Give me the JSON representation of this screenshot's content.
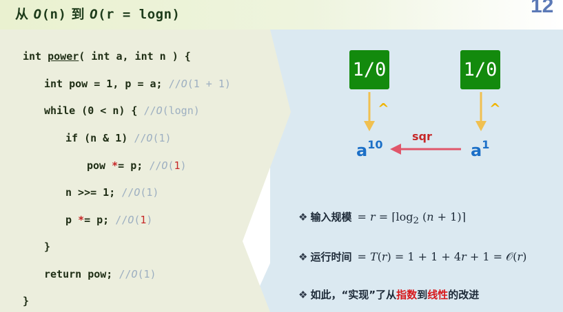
{
  "title": {
    "prefix": "从 ",
    "o1": "O",
    "part1": "(n)",
    "mid": " 到 ",
    "o2": "O",
    "part2": "(r = logn)"
  },
  "slide_number": "12",
  "code": {
    "lines": [
      {
        "kw": "int ",
        "fn": "power",
        "rest": "( int a, int n ) {"
      },
      {
        "code": "int pow = 1, p = a; ",
        "comment_prefix": "//",
        "comment_o": "O",
        "comment_rest": "(1 + 1)"
      },
      {
        "code": "while (0 < n) { ",
        "comment_prefix": "//",
        "comment_o": "O",
        "comment_rest": "(logn)"
      },
      {
        "code": "if (n & 1) ",
        "comment_prefix": "//",
        "comment_o": "O",
        "comment_rest": "(1)"
      },
      {
        "code_a": "pow ",
        "op": "*",
        "code_b": "= p; ",
        "comment_prefix": "//",
        "comment_o": "O",
        "comment_open": "(",
        "red": "1",
        "comment_close": ")"
      },
      {
        "code": "n >>= 1; ",
        "comment_prefix": "//",
        "comment_o": "O",
        "comment_rest": "(1)"
      },
      {
        "code_a": "p ",
        "op": "*",
        "code_b": "= p; ",
        "comment_prefix": "//",
        "comment_o": "O",
        "comment_open": "(",
        "red": "1",
        "comment_close": ")"
      },
      {
        "code": "}"
      },
      {
        "code": "return pow; ",
        "comment_prefix": "//",
        "comment_o": "O",
        "comment_rest": "(1)"
      },
      {
        "code": "}"
      }
    ]
  },
  "diagram": {
    "node_left": "1/0",
    "node_right": "1/0",
    "caret_left": "^",
    "caret_right": "^",
    "a_left_base": "a",
    "a_left_sup": "10",
    "a_right_base": "a",
    "a_right_sup": "1",
    "edge_label": "sqr"
  },
  "bullets": {
    "diamond": "❖",
    "b1_label": "输入规模",
    "b1_math": {
      "eq1": "= ",
      "r1": "r",
      "eq2": " = ⌈log",
      "sub": "2",
      "open": " (",
      "n": "n",
      "close": " + 1)⌉"
    },
    "b2_label": "运行时间",
    "b2_math": {
      "eq1": "= ",
      "T": "T",
      "r_open": "(",
      "r": "r",
      "r_close": ")",
      "mid": " = 1 + 1 + 4",
      "r2": "r",
      "tail": " + 1 = ",
      "O": "𝒪",
      "o_open": "(",
      "r3": "r",
      "o_close": ")"
    },
    "b3_a": "如此，“实现”了从",
    "b3_red1": "指数",
    "b3_mid": "到",
    "b3_red2": "线性",
    "b3_b": "的改进"
  },
  "colors": {
    "code_bg": "#eceedd",
    "diagram_bg": "#dbe9f1",
    "node_green": "#138a0d",
    "arrow_gold": "#f0c050",
    "arrow_red": "#e0566a",
    "label_blue": "#1b6fc7",
    "accent_red": "#d7191c"
  }
}
